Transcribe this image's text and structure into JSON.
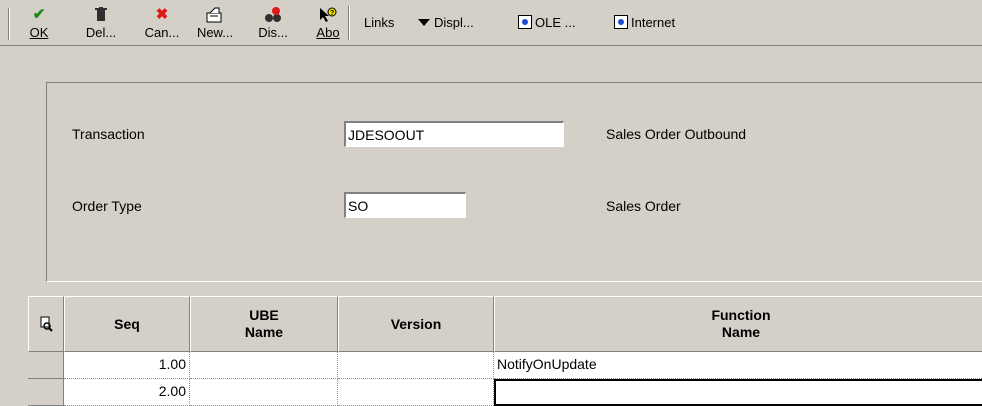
{
  "toolbar": {
    "buttons": [
      {
        "label": "OK",
        "icon": "✔",
        "color": "#1a8a1a"
      },
      {
        "label": "Del...",
        "icon": "🗑",
        "color": "#303030"
      },
      {
        "label": "Can...",
        "icon": "✖",
        "color": "#e01818"
      },
      {
        "label": "New...",
        "icon": "🖍",
        "color": "#303030"
      },
      {
        "label": "Dis...",
        "icon": "🔍",
        "color": "#c00000"
      },
      {
        "label": "Abo",
        "icon": "❓",
        "color": "#303030"
      }
    ],
    "links": "Links",
    "display": "Displ...",
    "ole": "OLE ...",
    "internet": "Internet"
  },
  "form": {
    "transaction_label": "Transaction",
    "transaction_value": "JDESOOUT",
    "transaction_desc": "Sales Order Outbound",
    "order_type_label": "Order Type",
    "order_type_value": "SO",
    "order_type_desc": "Sales Order"
  },
  "grid": {
    "headers": {
      "seq": "Seq",
      "ube_name": "UBE\nName",
      "version": "Version",
      "function_name": "Function\nName"
    },
    "rows": [
      {
        "seq": "1.00",
        "ube_name": "",
        "version": "",
        "function_name": "NotifyOnUpdate"
      },
      {
        "seq": "2.00",
        "ube_name": "",
        "version": "",
        "function_name": ""
      }
    ]
  }
}
